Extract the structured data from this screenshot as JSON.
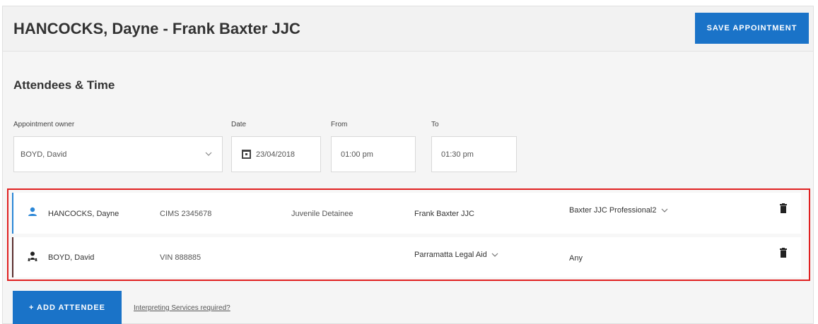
{
  "header": {
    "title": "HANCOCKS, Dayne - Frank Baxter JJC",
    "save_label": "SAVE APPOINTMENT"
  },
  "section": {
    "title": "Attendees & Time"
  },
  "form": {
    "owner_label": "Appointment owner",
    "owner_value": "BOYD, David",
    "date_label": "Date",
    "date_value": "23/04/2018",
    "from_label": "From",
    "from_value": "01:00 pm",
    "to_label": "To",
    "to_value": "01:30 pm"
  },
  "attendees": [
    {
      "name": "HANCOCKS, Dayne",
      "id": "CIMS 2345678",
      "role": "Juvenile Detainee",
      "organisation": "Frank Baxter JJC",
      "contact": "Baxter JJC Professional2",
      "icon": "person-icon",
      "accent": "#2a86d6"
    },
    {
      "name": "BOYD, David",
      "id": "VIN 888885",
      "role": "",
      "organisation": "Parramatta Legal Aid",
      "contact": "Any",
      "icon": "group-person-icon",
      "accent": "#5a2d2d"
    }
  ],
  "footer": {
    "add_label": "+ ADD ATTENDEE",
    "interpreting_link": "Interpreting Services required?"
  },
  "colors": {
    "primary": "#1a73c8",
    "highlight_border": "#e02020"
  }
}
